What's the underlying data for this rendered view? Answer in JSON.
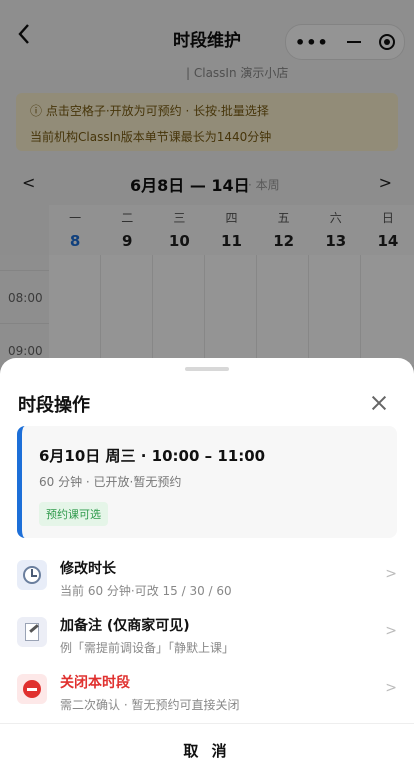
{
  "header": {
    "title": "时段维护",
    "subtitle": "| ClassIn 演示小店",
    "capsule": {
      "more_icon": "more-dots-icon",
      "minimize_icon": "minus-icon",
      "close_icon": "target-icon"
    }
  },
  "notice": {
    "line1": "ⓘ 点击空格子·开放为可预约 · 长按·批量选择",
    "line2": "当前机构ClassIn版本单节课最长为1440分钟"
  },
  "week": {
    "prev": "<",
    "range": "6月8日 — 14日",
    "current_label": "· 本周",
    "next": ">"
  },
  "days": [
    {
      "weekday": "一",
      "date": "8",
      "today": true
    },
    {
      "weekday": "二",
      "date": "9"
    },
    {
      "weekday": "三",
      "date": "10"
    },
    {
      "weekday": "四",
      "date": "11"
    },
    {
      "weekday": "五",
      "date": "12"
    },
    {
      "weekday": "六",
      "date": "13"
    },
    {
      "weekday": "日",
      "date": "14"
    }
  ],
  "times": [
    "08:00",
    "09:00"
  ],
  "sheet": {
    "title": "时段操作",
    "slot": {
      "time_line": "6月10日 周三 · 10:00 – 11:00",
      "meta": "60 分钟 · 已开放·暂无预约",
      "tag": "预约课可选"
    },
    "actions": [
      {
        "label": "修改时长",
        "sub": "当前 60 分钟·可改 15 / 30 / 60",
        "icon": "clock-icon"
      },
      {
        "label": "加备注 (仅商家可见)",
        "sub": "例「需提前调设备」「静默上课」",
        "icon": "memo-icon"
      },
      {
        "label": "关闭本时段",
        "sub": "需二次确认 · 暂无预约可直接关闭",
        "icon": "no-entry-icon",
        "danger": true
      }
    ],
    "cancel": "取 消",
    "chevron": ">"
  },
  "colors": {
    "accent": "#1d6fd8",
    "danger": "#e0312f",
    "tag_green": "#2e9a4b"
  }
}
